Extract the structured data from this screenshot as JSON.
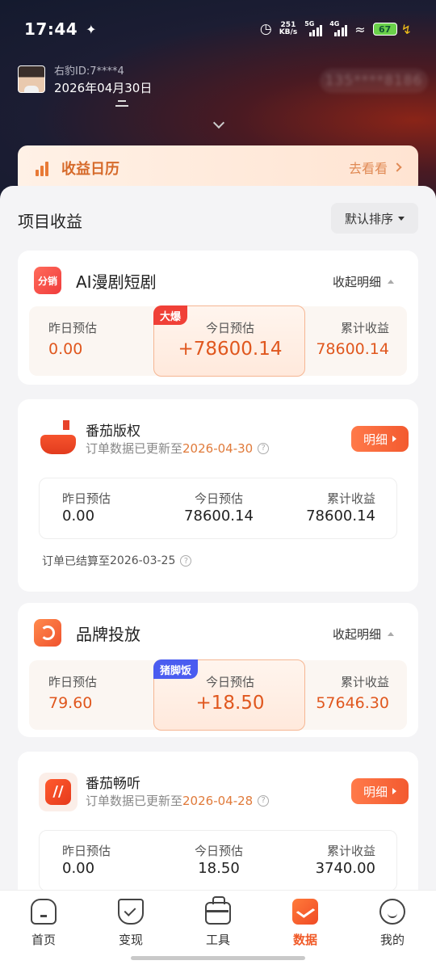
{
  "status_bar": {
    "time": "17:44",
    "speed_value": "251",
    "speed_unit": "KB/s",
    "net1": "5G",
    "net2": "4G",
    "battery": "67"
  },
  "user": {
    "id": "右豹ID:7****4",
    "date": "2026年04月30日",
    "masked_phone": "135****8186"
  },
  "calendar_banner": {
    "title": "收益日历",
    "link": "去看看"
  },
  "section": {
    "title": "项目收益",
    "sort_label": "默认排序"
  },
  "projects": [
    {
      "badge": "分销",
      "name": "AI漫剧短剧",
      "collapse_label": "收起明细",
      "tag": "大爆",
      "tag_color": "#f04037",
      "yesterday_label": "昨日预估",
      "yesterday": "0.00",
      "today_label": "今日预估",
      "today": "+78600.14",
      "total_label": "累计收益",
      "total": "78600.14",
      "sub": {
        "name": "番茄版权",
        "update_prefix": "订单数据已更新至",
        "update_date": "2026-04-30",
        "detail_label": "明细",
        "yesterday_label": "昨日预估",
        "yesterday": "0.00",
        "today_label": "今日预估",
        "today": "78600.14",
        "total_label": "累计收益",
        "total": "78600.14",
        "settle_prefix": "订单已结算至",
        "settle_date": "2026-03-25"
      }
    },
    {
      "name": "品牌投放",
      "collapse_label": "收起明细",
      "tag": "猪脚饭",
      "tag_color": "#4a5cf0",
      "yesterday_label": "昨日预估",
      "yesterday": "79.60",
      "today_label": "今日预估",
      "today": "+18.50",
      "total_label": "累计收益",
      "total": "57646.30",
      "sub": {
        "name": "番茄畅听",
        "update_prefix": "订单数据已更新至",
        "update_date": "2026-04-28",
        "detail_label": "明细",
        "yesterday_label": "昨日预估",
        "yesterday": "0.00",
        "today_label": "今日预估",
        "today": "18.50",
        "total_label": "累计收益",
        "total": "3740.00"
      }
    }
  ],
  "tabs": [
    {
      "label": "首页",
      "icon": "home-icon"
    },
    {
      "label": "变现",
      "icon": "shield-check-icon"
    },
    {
      "label": "工具",
      "icon": "toolbag-icon"
    },
    {
      "label": "数据",
      "icon": "chart-icon",
      "active": true
    },
    {
      "label": "我的",
      "icon": "smile-icon"
    }
  ],
  "colors": {
    "accent": "#f05a28",
    "value_orange": "#e0571e",
    "tag_red": "#f04037",
    "tag_blue": "#4a5cf0"
  }
}
